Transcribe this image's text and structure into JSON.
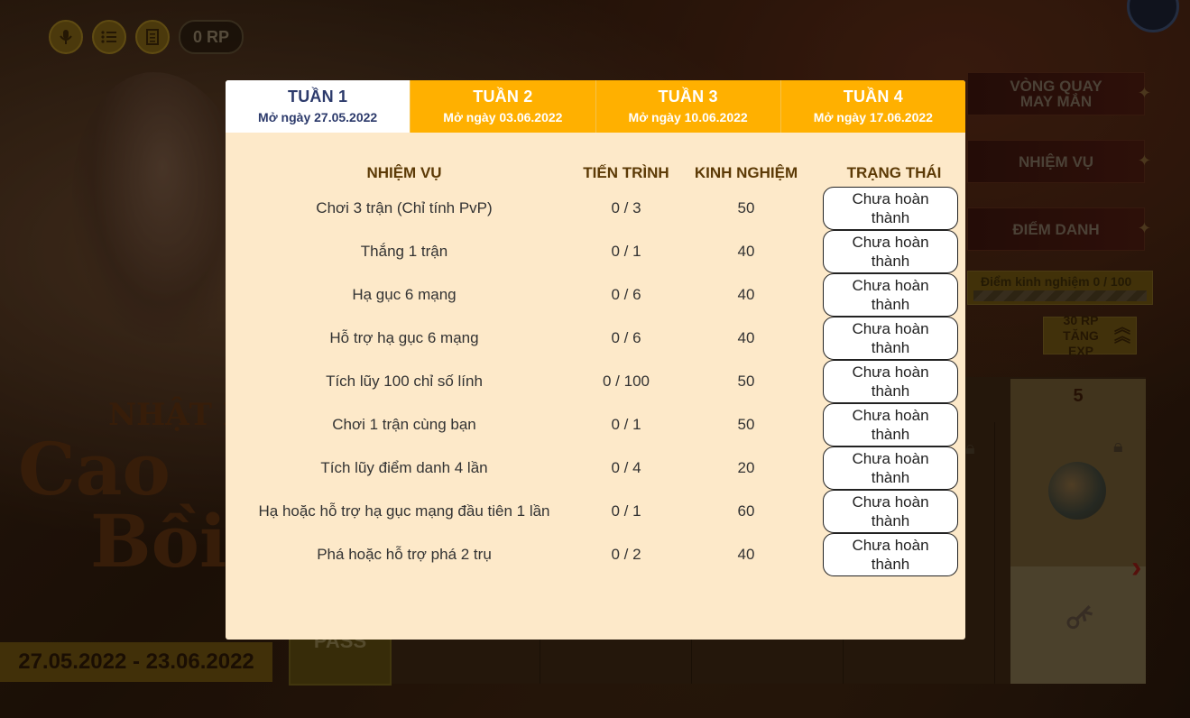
{
  "header": {
    "rp_label": "0 RP",
    "icons": [
      "mic-icon",
      "list-icon",
      "document-icon"
    ]
  },
  "side_menu": {
    "lucky_spin": "VÒNG QUAY MAY MẮN",
    "missions": "NHIỆM VỤ",
    "checkin": "ĐIỂM DANH",
    "exp_progress": "Điểm kinh nghiệm 0 / 100",
    "rp_exp_line1": "30 RP",
    "rp_exp_line2": "TĂNG EXP"
  },
  "event": {
    "date_range": "27.05.2022 - 23.06.2022",
    "title_line1": "NHẬT KÝ",
    "title_line2": "Cao",
    "title_line3": "Bồi",
    "pass_label": "PASS",
    "level_number": "5"
  },
  "tabs": [
    {
      "title": "TUẦN 1",
      "subtitle": "Mở ngày 27.05.2022",
      "active": true
    },
    {
      "title": "TUẦN 2",
      "subtitle": "Mở ngày 03.06.2022",
      "active": false
    },
    {
      "title": "TUẦN 3",
      "subtitle": "Mở ngày 10.06.2022",
      "active": false
    },
    {
      "title": "TUẦN 4",
      "subtitle": "Mở ngày 17.06.2022",
      "active": false
    }
  ],
  "table": {
    "headers": {
      "quest": "NHIỆM VỤ",
      "progress": "TIẾN TRÌNH",
      "exp": "KINH NGHIỆM",
      "status": "TRẠNG THÁI"
    },
    "rows": [
      {
        "quest": "Chơi 3 trận (Chỉ tính PvP)",
        "progress": "0 / 3",
        "exp": "50",
        "status": "Chưa hoàn thành"
      },
      {
        "quest": "Thắng 1 trận",
        "progress": "0 / 1",
        "exp": "40",
        "status": "Chưa hoàn thành"
      },
      {
        "quest": "Hạ gục 6 mạng",
        "progress": "0 / 6",
        "exp": "40",
        "status": "Chưa hoàn thành"
      },
      {
        "quest": "Hỗ trợ hạ gục 6 mạng",
        "progress": "0 / 6",
        "exp": "40",
        "status": "Chưa hoàn thành"
      },
      {
        "quest": "Tích lũy 100 chỉ số lính",
        "progress": "0 / 100",
        "exp": "50",
        "status": "Chưa hoàn thành"
      },
      {
        "quest": "Chơi 1 trận cùng bạn",
        "progress": "0 / 1",
        "exp": "50",
        "status": "Chưa hoàn thành"
      },
      {
        "quest": "Tích lũy điểm danh 4 lần",
        "progress": "0 / 4",
        "exp": "20",
        "status": "Chưa hoàn thành"
      },
      {
        "quest": "Hạ hoặc hỗ trợ hạ gục mạng đầu tiên 1 lần",
        "progress": "0 / 1",
        "exp": "60",
        "status": "Chưa hoàn thành"
      },
      {
        "quest": "Phá hoặc hỗ trợ phá 2 trụ",
        "progress": "0 / 2",
        "exp": "40",
        "status": "Chưa hoàn thành"
      }
    ]
  },
  "colors": {
    "tab_inactive": "#ffb000",
    "tab_active_text": "#2c3a6b",
    "modal_bg": "#fde9c9",
    "header_text": "#5c3a06"
  }
}
